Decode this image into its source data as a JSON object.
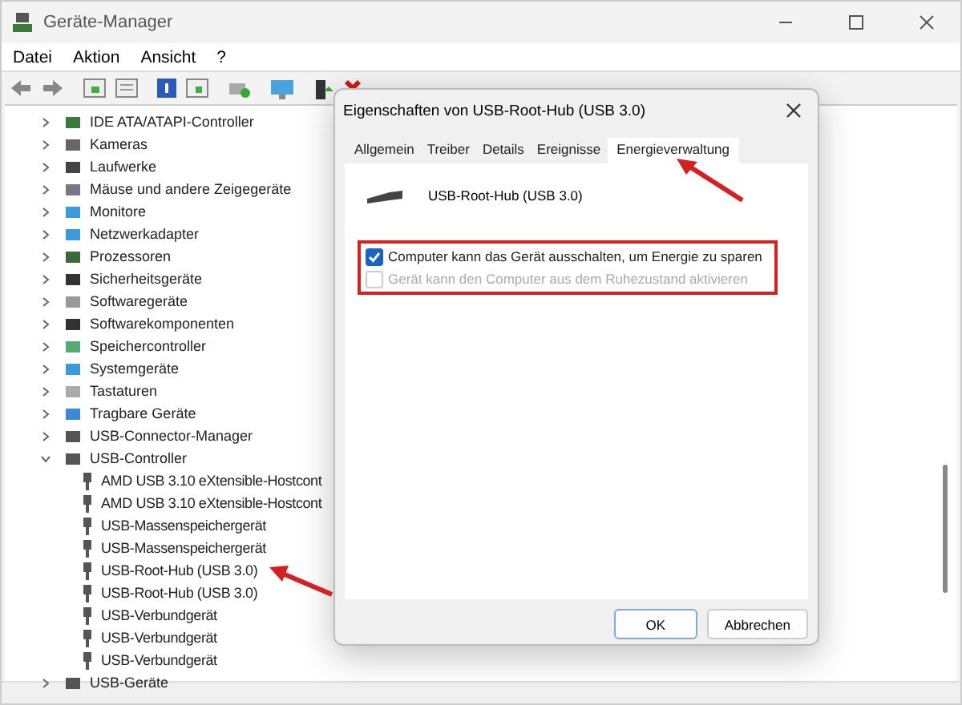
{
  "window": {
    "title": "Geräte-Manager"
  },
  "menu": [
    "Datei",
    "Aktion",
    "Ansicht",
    "?"
  ],
  "tree": [
    {
      "label": "IDE ATA/ATAPI-Controller",
      "expanded": false
    },
    {
      "label": "Kameras",
      "expanded": false
    },
    {
      "label": "Laufwerke",
      "expanded": false
    },
    {
      "label": "Mäuse und andere Zeigegeräte",
      "expanded": false
    },
    {
      "label": "Monitore",
      "expanded": false
    },
    {
      "label": "Netzwerkadapter",
      "expanded": false
    },
    {
      "label": "Prozessoren",
      "expanded": false
    },
    {
      "label": "Sicherheitsgeräte",
      "expanded": false
    },
    {
      "label": "Softwaregeräte",
      "expanded": false
    },
    {
      "label": "Softwarekomponenten",
      "expanded": false
    },
    {
      "label": "Speichercontroller",
      "expanded": false
    },
    {
      "label": "Systemgeräte",
      "expanded": false
    },
    {
      "label": "Tastaturen",
      "expanded": false
    },
    {
      "label": "Tragbare Geräte",
      "expanded": false
    },
    {
      "label": "USB-Connector-Manager",
      "expanded": false
    },
    {
      "label": "USB-Controller",
      "expanded": true,
      "children": [
        {
          "label": "AMD USB 3.10 eXtensible-Hostcont"
        },
        {
          "label": "AMD USB 3.10 eXtensible-Hostcont"
        },
        {
          "label": "USB-Massenspeichergerät"
        },
        {
          "label": "USB-Massenspeichergerät"
        },
        {
          "label": "USB-Root-Hub (USB 3.0)"
        },
        {
          "label": "USB-Root-Hub (USB 3.0)"
        },
        {
          "label": "USB-Verbundgerät"
        },
        {
          "label": "USB-Verbundgerät"
        },
        {
          "label": "USB-Verbundgerät"
        }
      ]
    },
    {
      "label": "USB-Geräte",
      "expanded": false
    }
  ],
  "dialog": {
    "title": "Eigenschaften von USB-Root-Hub (USB 3.0)",
    "tabs": [
      {
        "label": "Allgemein",
        "selected": false
      },
      {
        "label": "Treiber",
        "selected": false
      },
      {
        "label": "Details",
        "selected": false
      },
      {
        "label": "Ereignisse",
        "selected": false
      },
      {
        "label": "Energieverwaltung",
        "selected": true
      }
    ],
    "device_name": "USB-Root-Hub (USB 3.0)",
    "options": [
      {
        "label": "Computer kann das Gerät ausschalten, um Energie zu sparen",
        "checked": true,
        "disabled": false
      },
      {
        "label": "Gerät kann den Computer aus dem Ruhezustand aktivieren",
        "checked": false,
        "disabled": true
      }
    ],
    "buttons": [
      "OK",
      "Abbrechen"
    ]
  }
}
